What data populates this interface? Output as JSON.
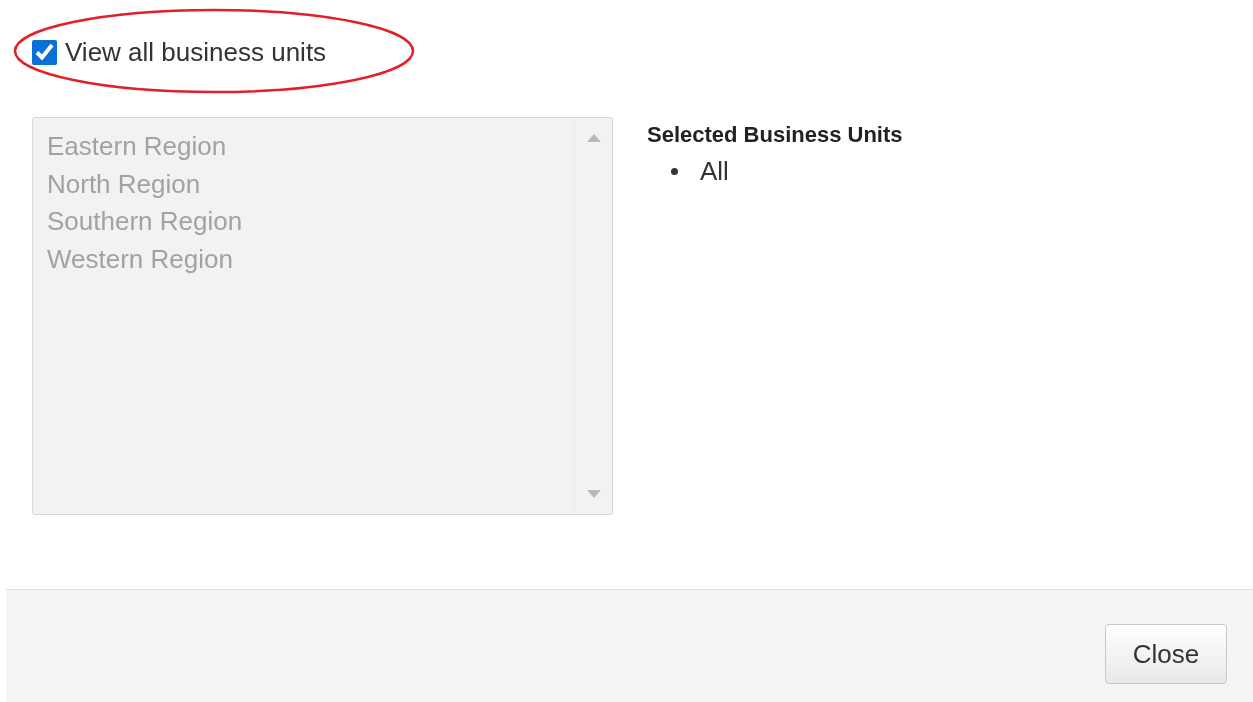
{
  "view_all": {
    "label": "View all business units",
    "checked": true
  },
  "business_units": {
    "disabled": true,
    "items": [
      {
        "label": "Eastern Region"
      },
      {
        "label": "North Region"
      },
      {
        "label": "Southern Region"
      },
      {
        "label": "Western Region"
      }
    ]
  },
  "selected_panel": {
    "heading": "Selected Business Units",
    "items": [
      "All"
    ]
  },
  "footer": {
    "buttons": [
      "Close"
    ]
  }
}
